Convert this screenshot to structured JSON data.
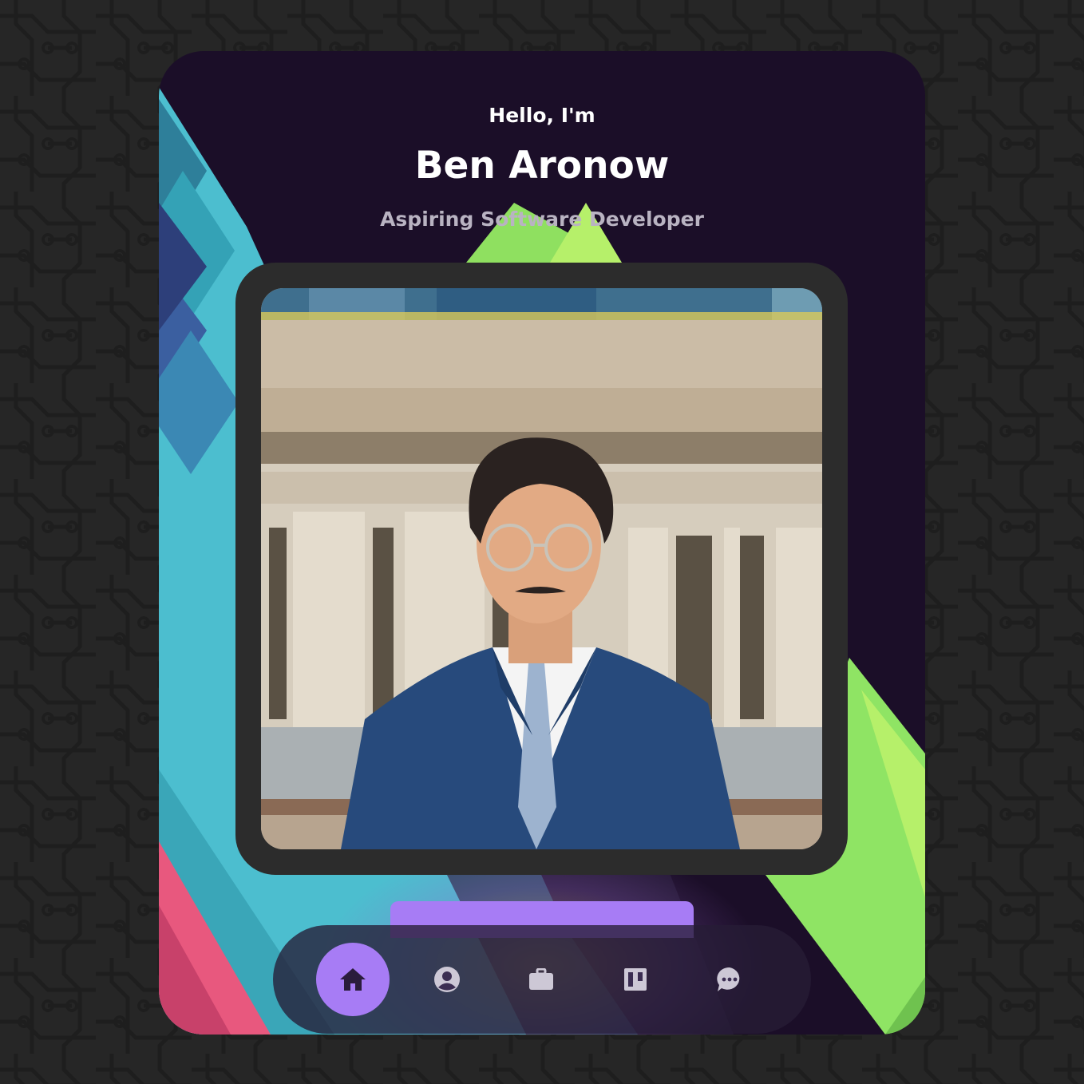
{
  "hero": {
    "greeting": "Hello, I'm",
    "name": "Ben Aronow",
    "role": "Aspiring Software Developer"
  },
  "photo": {
    "alt": "Ben Aronow portrait"
  },
  "nav": {
    "items": [
      {
        "icon": "home-icon",
        "active": true
      },
      {
        "icon": "user-icon",
        "active": false
      },
      {
        "icon": "briefcase-icon",
        "active": false
      },
      {
        "icon": "board-icon",
        "active": false
      },
      {
        "icon": "chat-icon",
        "active": false
      }
    ]
  },
  "colors": {
    "page_background": "#262626",
    "card_background": "#1b0e28",
    "accent": "#a77cf5",
    "teal": "#4cbecf",
    "green": "#9be864",
    "pink": "#e8587e"
  }
}
